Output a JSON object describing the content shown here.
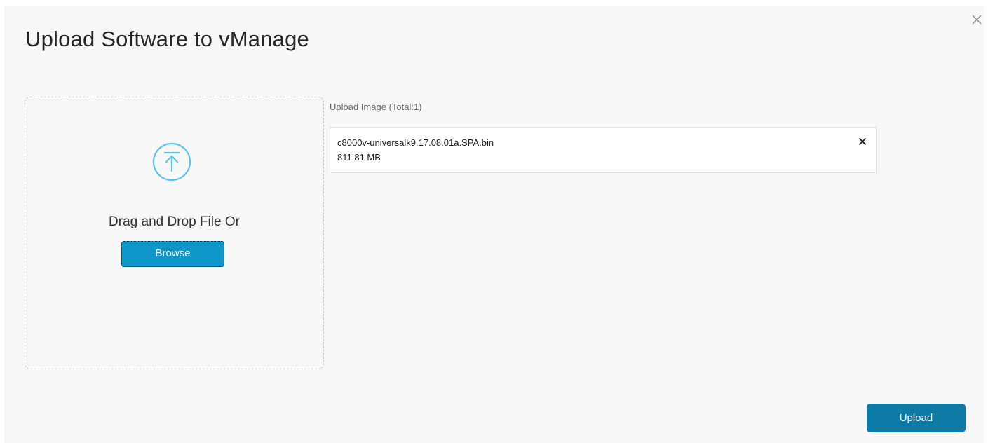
{
  "dialog": {
    "title": "Upload Software to vManage",
    "close_icon": "close-icon"
  },
  "dropzone": {
    "icon": "upload-arrow-icon",
    "instruction": "Drag and Drop File Or",
    "browse_label": "Browse"
  },
  "upload_list": {
    "label": "Upload Image (Total:1)",
    "files": [
      {
        "name": "c8000v-universalk9.17.08.01a.SPA.bin",
        "size": "811.81 MB",
        "remove_icon": "remove-icon"
      }
    ]
  },
  "footer": {
    "upload_label": "Upload"
  },
  "colors": {
    "accent": "#0d97c9",
    "primary_button": "#0e7ba6",
    "upload_icon": "#5cc3e6",
    "dialog_background": "#f7f7f7"
  }
}
